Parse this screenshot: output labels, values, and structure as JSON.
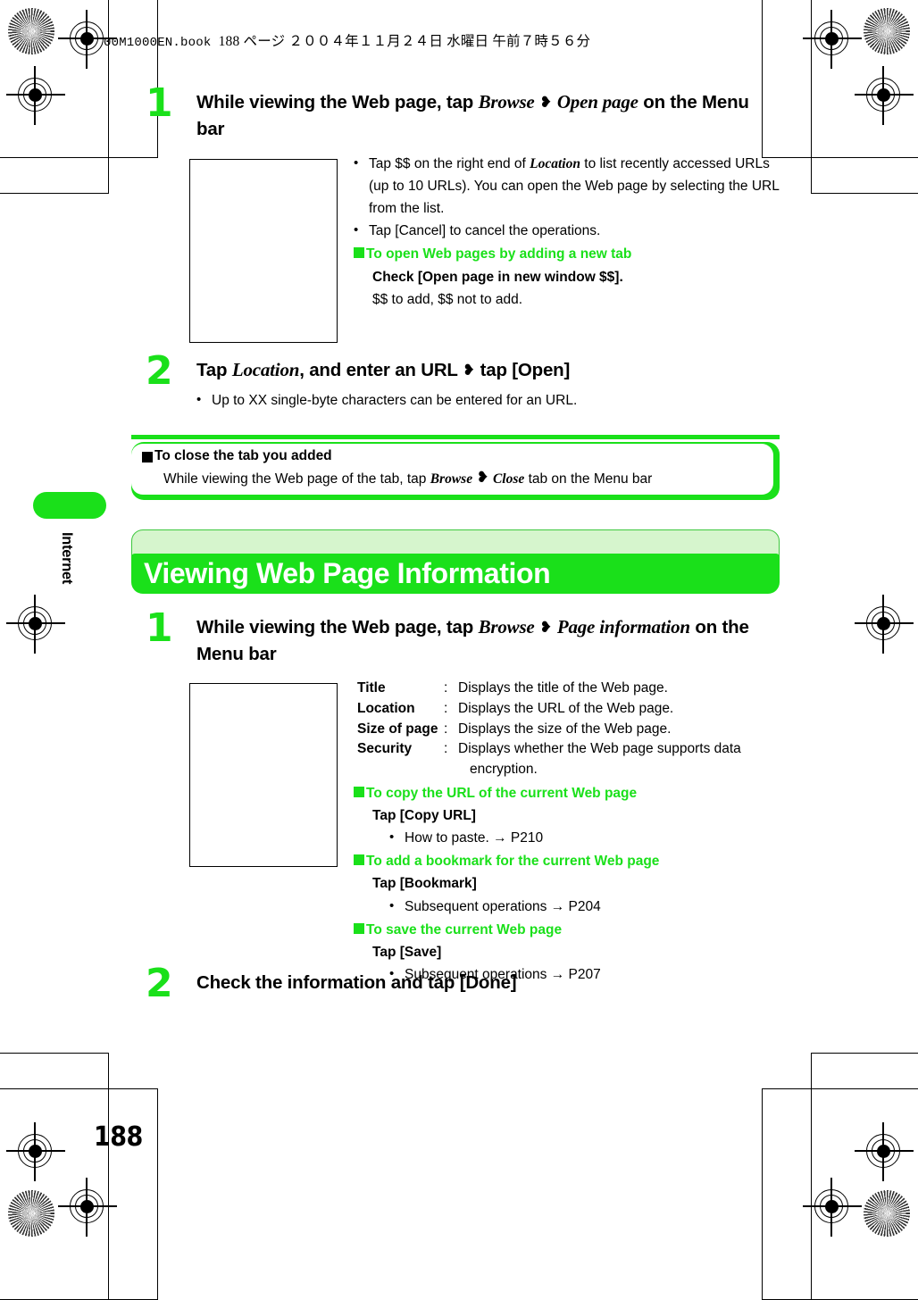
{
  "header": {
    "slug_file": "00M1000EN.book",
    "slug_rest": "188 ページ  ２００４年１１月２４日  水曜日  午前７時５６分"
  },
  "side_tab": {
    "label": "Internet"
  },
  "folio": {
    "page_number": "188"
  },
  "colors": {
    "accent_green": "#1ae01a",
    "banner_cap": "#d6f5cd",
    "text": "#000000"
  },
  "section_1": {
    "step1": {
      "number": "1",
      "title_part1": "While viewing the Web page, tap ",
      "title_em1": "Browse",
      "title_arrow": "❥",
      "title_em2": "Open page",
      "title_part2": " on the Menu bar",
      "notes": {
        "bullet1_pre": "Tap $$ on the right end of ",
        "bullet1_em": "Location",
        "bullet1_post": " to list recently accessed URLs (up to 10 URLs). You can open the Web page by selecting the URL from the list.",
        "bullet2": "Tap [Cancel] to cancel the operations.",
        "green_head": "To open Web pages by adding a new tab",
        "bold_line": "Check [Open page in new window $$].",
        "plain_line": "$$ to add, $$ not to add."
      }
    },
    "step2": {
      "number": "2",
      "title_part1": "Tap ",
      "title_em1": "Location",
      "title_part2": ", and enter an URL ",
      "title_arrow": "❥",
      "title_part3": " tap [Open]",
      "bullet1": "Up to XX single-byte characters can be entered for an URL."
    }
  },
  "callout": {
    "heading": "To close the tab you added",
    "body_pre": "While viewing the Web page of the tab, tap ",
    "body_em1": "Browse",
    "body_arrow": "❥",
    "body_em2": "Close",
    "body_post": " tab on the Menu bar"
  },
  "banner": {
    "title": "Viewing Web Page Information"
  },
  "section_2": {
    "step1": {
      "number": "1",
      "title_part1": "While viewing the Web page, tap ",
      "title_em1": "Browse",
      "title_arrow": "❥",
      "title_em2": "Page information",
      "title_part2": " on the Menu bar"
    },
    "definitions": [
      {
        "term": "Title",
        "colon": ":",
        "desc": "Displays the title of the Web page."
      },
      {
        "term": "Location",
        "colon": ":",
        "desc": "Displays the URL of the Web page."
      },
      {
        "term": "Size of page",
        "colon": ":",
        "desc": "Displays the size of the Web page."
      },
      {
        "term": "Security",
        "colon": ":",
        "desc": "Displays whether the Web page supports data"
      }
    ],
    "security_cont": "encryption.",
    "subsections": [
      {
        "green_head": "To copy the URL of the current Web page",
        "bold_line": "Tap [Copy URL]",
        "bullet_text": "How to paste. ",
        "bullet_arrow": "→",
        "bullet_ref": " P210"
      },
      {
        "green_head": "To add a bookmark for the current Web page",
        "bold_line": "Tap [Bookmark]",
        "bullet_text": "Subsequent operations ",
        "bullet_arrow": "→",
        "bullet_ref": " P204"
      },
      {
        "green_head": "To save the current Web page",
        "bold_line": "Tap [Save]",
        "bullet_text": "Subsequent operations ",
        "bullet_arrow": "→",
        "bullet_ref": " P207"
      }
    ],
    "step2": {
      "number": "2",
      "title": "Check the information and tap [Done]"
    }
  }
}
